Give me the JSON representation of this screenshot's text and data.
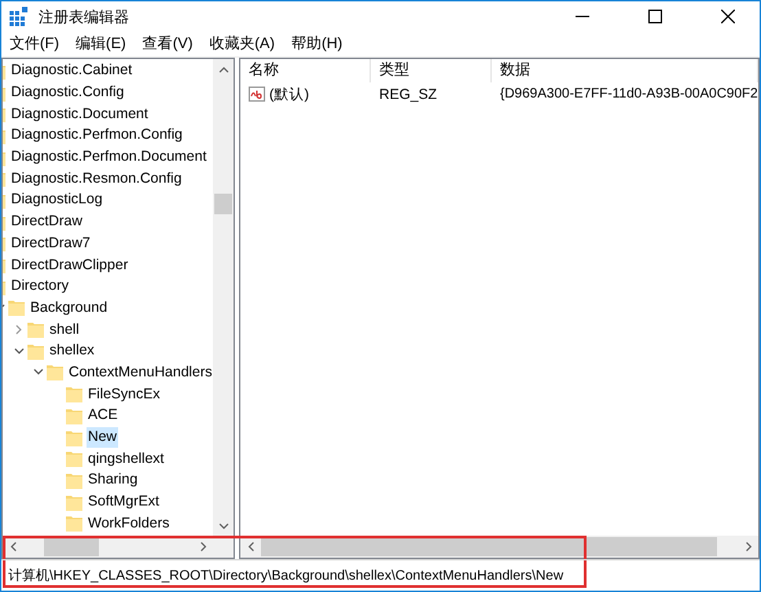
{
  "window": {
    "title": "注册表编辑器"
  },
  "menu": [
    "文件(F)",
    "编辑(E)",
    "查看(V)",
    "收藏夹(A)",
    "帮助(H)"
  ],
  "tree": [
    {
      "label": "Diagnostic.Cabinet"
    },
    {
      "label": "Diagnostic.Config"
    },
    {
      "label": "Diagnostic.Document"
    },
    {
      "label": "Diagnostic.Perfmon.Config"
    },
    {
      "label": "Diagnostic.Perfmon.Document"
    },
    {
      "label": "Diagnostic.Resmon.Config"
    },
    {
      "label": "DiagnosticLog"
    },
    {
      "label": "DirectDraw"
    },
    {
      "label": "DirectDraw7"
    },
    {
      "label": "DirectDrawClipper"
    },
    {
      "label": "Directory",
      "children": [
        {
          "label": "Background",
          "expanded": true,
          "children": [
            {
              "label": "shell",
              "expanded": false
            },
            {
              "label": "shellex",
              "expanded": true,
              "children": [
                {
                  "label": "ContextMenuHandlers",
                  "expanded": true,
                  "children": [
                    {
                      "label": "FileSyncEx",
                      "selected": false
                    },
                    {
                      "label": "ACE",
                      "selected": false
                    },
                    {
                      "label": "New",
                      "selected": true
                    },
                    {
                      "label": "qingshellext",
                      "selected": false
                    },
                    {
                      "label": "Sharing",
                      "selected": false
                    },
                    {
                      "label": "SoftMgrExt",
                      "selected": false
                    },
                    {
                      "label": "WorkFolders",
                      "selected": false
                    }
                  ]
                }
              ]
            }
          ]
        }
      ]
    }
  ],
  "table": {
    "columns": [
      "名称",
      "类型",
      "数据"
    ],
    "rows": [
      {
        "name": "(默认)",
        "type": "REG_SZ",
        "data": "{D969A300-E7FF-11d0-A93B-00A0C90F2"
      }
    ]
  },
  "status_bar": "计算机\\HKEY_CLASSES_ROOT\\Directory\\Background\\shellex\\ContextMenuHandlers\\New"
}
